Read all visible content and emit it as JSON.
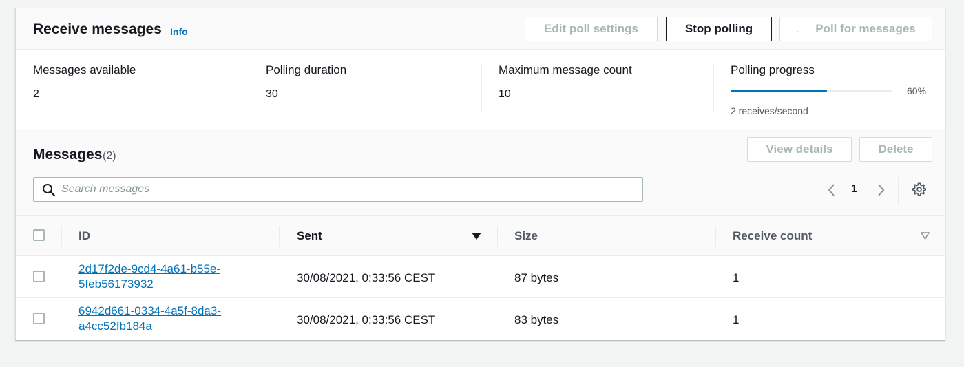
{
  "header": {
    "title": "Receive messages",
    "info_label": "Info",
    "edit_poll_settings_label": "Edit poll settings",
    "stop_polling_label": "Stop polling",
    "poll_for_messages_label": "Poll for messages"
  },
  "stats": {
    "messages_available_label": "Messages available",
    "messages_available_value": "2",
    "polling_duration_label": "Polling duration",
    "polling_duration_value": "30",
    "max_message_count_label": "Maximum message count",
    "max_message_count_value": "10",
    "polling_progress_label": "Polling progress",
    "polling_progress_fraction": 0.6,
    "polling_progress_percent": "60%",
    "polling_progress_desc": "2 receives/second"
  },
  "messages": {
    "title": "Messages",
    "count": "(2)",
    "view_details_label": "View details",
    "delete_label": "Delete",
    "search_placeholder": "Search messages",
    "page_number": "1"
  },
  "table": {
    "columns": {
      "id": "ID",
      "sent": "Sent",
      "size": "Size",
      "receive_count": "Receive count"
    },
    "rows": [
      {
        "id_line1": "2d17f2de-9cd4-4a61-b55e-",
        "id_line2": "5feb56173932",
        "sent": "30/08/2021, 0:33:56 CEST",
        "size": "87 bytes",
        "receive_count": "1"
      },
      {
        "id_line1": "6942d661-0334-4a5f-8da3-",
        "id_line2": "a4cc52fb184a",
        "sent": "30/08/2021, 0:33:56 CEST",
        "size": "83 bytes",
        "receive_count": "1"
      }
    ]
  },
  "colors": {
    "accent": "#0073bb",
    "text": "#16191f",
    "disabled": "#aab7b8"
  }
}
